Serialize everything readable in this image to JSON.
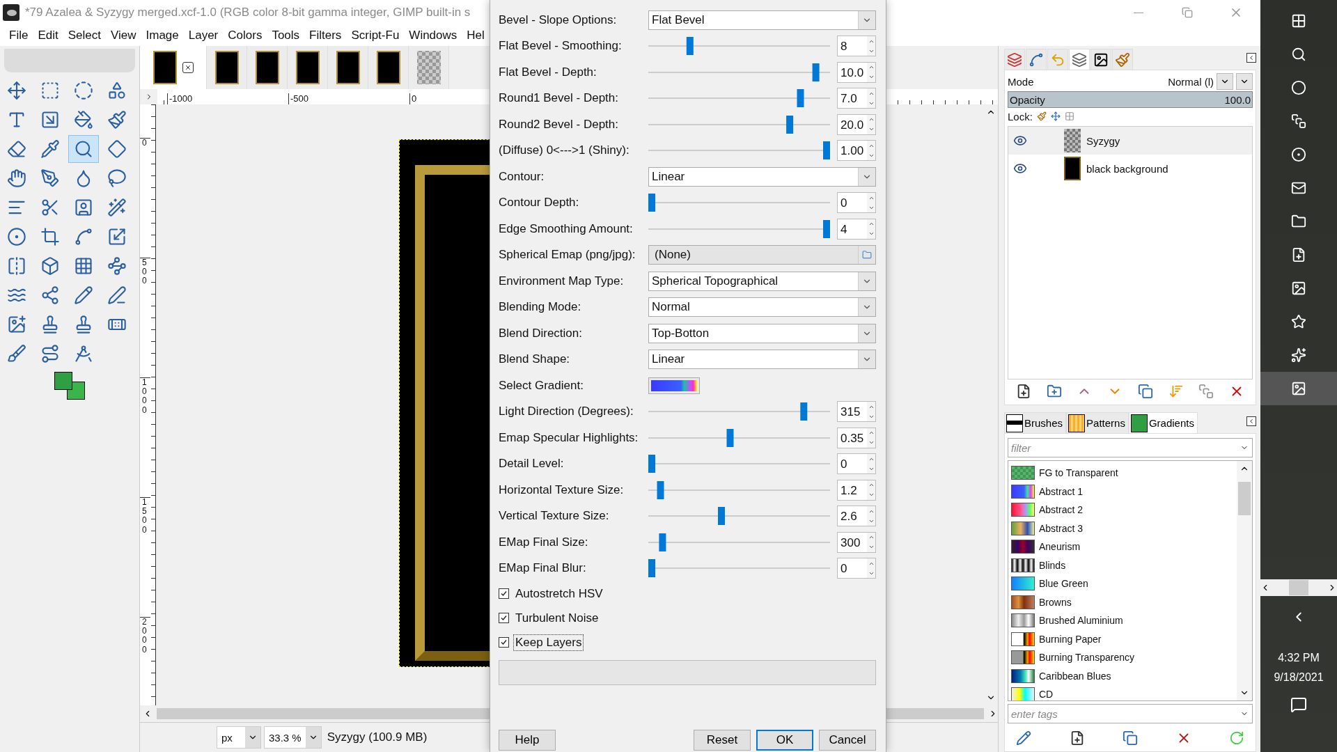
{
  "window": {
    "title": "*79 Azalea & Syzygy merged.xcf-1.0 (RGB color 8-bit gamma integer, GIMP built-in s"
  },
  "menu": [
    "File",
    "Edit",
    "Select",
    "View",
    "Image",
    "Layer",
    "Colors",
    "Tools",
    "Filters",
    "Script-Fu",
    "Windows",
    "Hel"
  ],
  "toolbox": {
    "tools": [
      {
        "selected": false
      },
      {
        "selected": false
      },
      {
        "selected": false
      },
      {
        "selected": false
      },
      {
        "selected": false
      },
      {
        "selected": false
      },
      {
        "selected": false
      },
      {
        "selected": false
      },
      {
        "selected": false
      },
      {
        "selected": false
      },
      {
        "selected": true
      },
      {
        "selected": false
      },
      {
        "selected": false
      },
      {
        "selected": false
      },
      {
        "selected": false
      },
      {
        "selected": false
      },
      {
        "selected": false
      },
      {
        "selected": false
      },
      {
        "selected": false
      },
      {
        "selected": false
      },
      {
        "selected": false
      },
      {
        "selected": false
      },
      {
        "selected": false
      },
      {
        "selected": false
      },
      {
        "selected": false
      },
      {
        "selected": false
      },
      {
        "selected": false
      },
      {
        "selected": false
      },
      {
        "selected": false
      },
      {
        "selected": false
      },
      {
        "selected": false
      },
      {
        "selected": false
      },
      {
        "selected": false
      },
      {
        "selected": false
      },
      {
        "selected": false
      },
      {
        "selected": false
      },
      {
        "selected": false
      },
      {
        "selected": false
      },
      {
        "selected": false
      }
    ]
  },
  "image_tabs": [
    {
      "selected": true
    },
    {
      "selected": false
    },
    {
      "selected": false
    },
    {
      "selected": false
    },
    {
      "selected": false
    },
    {
      "selected": false
    },
    {
      "selected": false
    }
  ],
  "rulers": {
    "horizontal": [
      "-1000",
      "-500",
      "0"
    ],
    "vertical": [
      "0",
      "500",
      "1000",
      "1500",
      "2000"
    ]
  },
  "status_bar": {
    "unit": "px",
    "zoom": "33.3 %",
    "info": "Syzygy (100.9 MB)"
  },
  "dialog": {
    "fields": [
      {
        "kind": "dropdown",
        "label": "Bevel - Slope Options:",
        "value": "Flat Bevel"
      },
      {
        "kind": "slider",
        "label": "Flat Bevel - Smoothing:",
        "value": "8",
        "level": 0.22
      },
      {
        "kind": "slider",
        "label": "Flat Bevel - Depth:",
        "value": "10.0",
        "level": 0.94
      },
      {
        "kind": "slider",
        "label": "Round1 Bevel - Depth:",
        "value": "7.0",
        "level": 0.85
      },
      {
        "kind": "slider",
        "label": "Round2 Bevel - Depth:",
        "value": "20.0",
        "level": 0.79
      },
      {
        "kind": "slider",
        "label": "(Diffuse) 0<--->1 (Shiny):",
        "value": "1.00",
        "level": 1
      },
      {
        "kind": "dropdown",
        "label": "Contour:",
        "value": "Linear"
      },
      {
        "kind": "slider",
        "label": "Contour Depth:",
        "value": "0",
        "level": 0
      },
      {
        "kind": "slider",
        "label": "Edge Smoothing Amount:",
        "value": "4",
        "level": 1
      },
      {
        "kind": "file",
        "label": "Spherical Emap (png/jpg):",
        "value": "(None)"
      },
      {
        "kind": "dropdown",
        "label": "Environment Map Type:",
        "value": "Spherical Topographical"
      },
      {
        "kind": "dropdown",
        "label": "Blending Mode:",
        "value": "Normal"
      },
      {
        "kind": "dropdown",
        "label": "Blend Direction:",
        "value": "Top-Botton"
      },
      {
        "kind": "dropdown",
        "label": "Blend Shape:",
        "value": "Linear"
      },
      {
        "kind": "gradient",
        "label": "Select Gradient:"
      },
      {
        "kind": "slider",
        "label": "Light Direction (Degrees):",
        "value": "315",
        "level": 0.87
      },
      {
        "kind": "slider",
        "label": "Emap Specular Highlights:",
        "value": "0.35",
        "level": 0.45
      },
      {
        "kind": "slider",
        "label": "Detail Level:",
        "value": "0",
        "level": 0
      },
      {
        "kind": "slider",
        "label": "Horizontal Texture Size:",
        "value": "1.2",
        "level": 0.05
      },
      {
        "kind": "slider",
        "label": "Vertical Texture Size:",
        "value": "2.6",
        "level": 0.4
      },
      {
        "kind": "slider",
        "label": "EMap Final Size:",
        "value": "300",
        "level": 0.06
      },
      {
        "kind": "slider",
        "label": "EMap Final Blur:",
        "value": "0",
        "level": 0
      }
    ],
    "checkboxes": [
      {
        "label": "Autostretch HSV",
        "checked": true,
        "focused": false
      },
      {
        "label": "Turbulent Noise",
        "checked": true,
        "focused": false
      },
      {
        "label": "Keep Layers",
        "checked": true,
        "focused": true
      }
    ],
    "progress": {
      "level": 0
    },
    "buttons": [
      {
        "label": "Help",
        "default": false
      },
      {
        "label": "Reset",
        "default": false
      },
      {
        "label": "OK",
        "default": true
      },
      {
        "label": "Cancel",
        "default": false
      }
    ]
  },
  "dock": {
    "tabs": [
      {
        "selected": false
      },
      {
        "selected": false
      },
      {
        "selected": false
      },
      {
        "selected": true
      },
      {
        "selected": false
      },
      {
        "selected": false
      }
    ],
    "mode_label": "Mode",
    "mode": "Normal (l)",
    "opacity": {
      "label": "Opacity",
      "value": "100.0",
      "level": 1
    },
    "lock_label": "Lock:",
    "layers": [
      {
        "name": "Syzygy",
        "visible": true,
        "selected": true
      },
      {
        "name": "black background",
        "visible": true,
        "selected": false
      }
    ],
    "resource_tabs": [
      {
        "label": "Brushes",
        "selected": false
      },
      {
        "label": "Patterns",
        "selected": false
      },
      {
        "label": "Gradients",
        "selected": true
      }
    ],
    "filter": {
      "placeholder": "filter"
    },
    "gradients": [
      "FG to Transparent",
      "Abstract 1",
      "Abstract 2",
      "Abstract 3",
      "Aneurism",
      "Blinds",
      "Blue Green",
      "Browns",
      "Brushed Aluminium",
      "Burning Paper",
      "Burning Transparency",
      "Caribbean Blues",
      "CD"
    ],
    "tags": {
      "placeholder": "enter tags"
    }
  },
  "taskbar": {
    "time": "4:32 PM",
    "date": "9/18/2021"
  }
}
